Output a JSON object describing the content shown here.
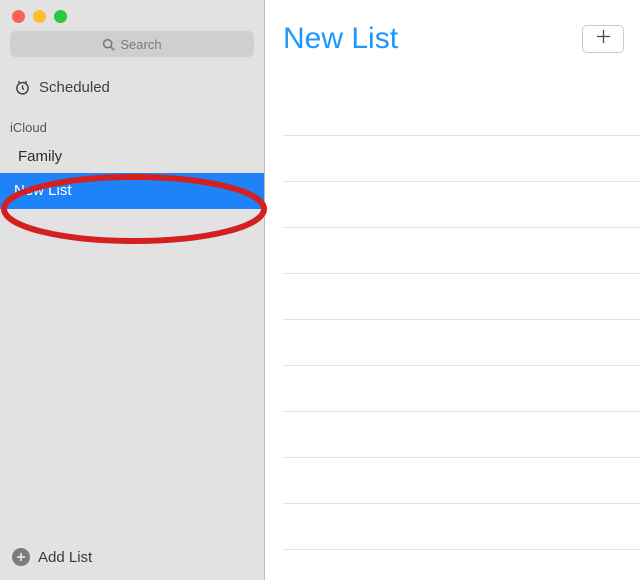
{
  "search": {
    "placeholder": "Search"
  },
  "sidebar": {
    "scheduled": "Scheduled",
    "section": "iCloud",
    "items": [
      {
        "label": "Family",
        "selected": false
      },
      {
        "label": "New List",
        "selected": true
      }
    ],
    "addList": "Add List"
  },
  "main": {
    "title": "New List"
  },
  "colors": {
    "accent": "#1c97ff",
    "selection": "#1e82f8",
    "sidebarBg": "#e2e2e2"
  }
}
